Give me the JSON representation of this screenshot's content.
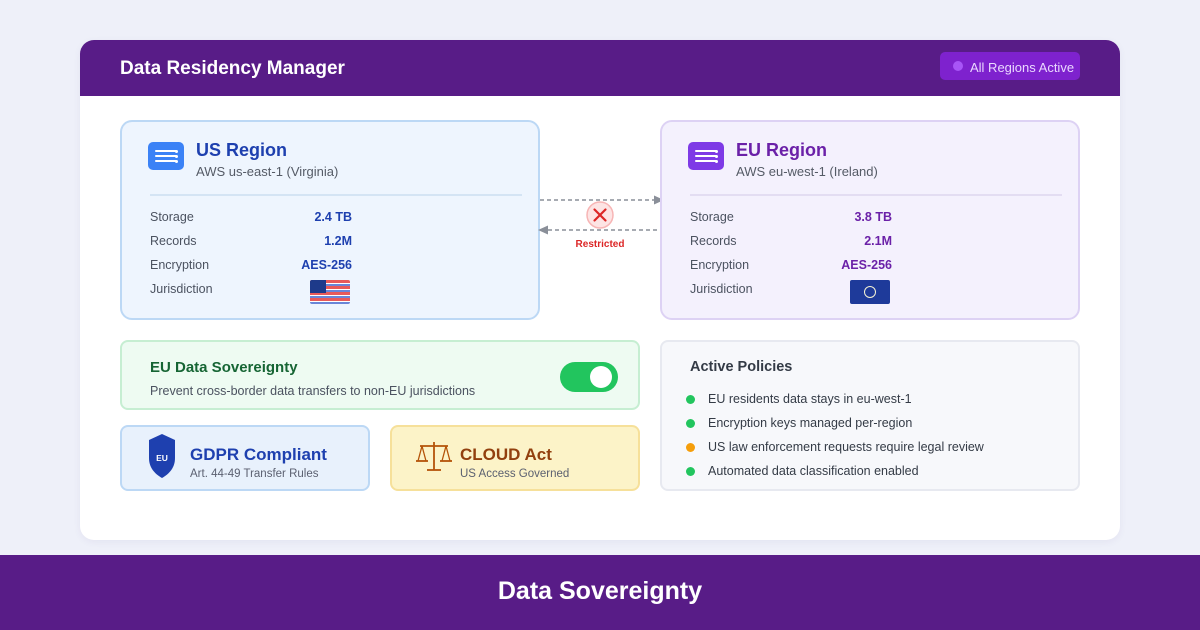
{
  "header": {
    "title": "Data Residency Manager",
    "status_label": "All Regions Active",
    "status_color": "#a855f7"
  },
  "regions": {
    "us": {
      "name": "US Region",
      "provider": "AWS us-east-1 (Virginia)",
      "icon": "server-icon",
      "stats": {
        "storage_label": "Storage",
        "storage_value": "2.4 TB",
        "records_label": "Records",
        "records_value": "1.2M",
        "encryption_label": "Encryption",
        "encryption_value": "AES-256",
        "jurisdiction_label": "Jurisdiction",
        "jurisdiction_flag": "us-flag-icon"
      },
      "accent": "#1e40af"
    },
    "eu": {
      "name": "EU Region",
      "provider": "AWS eu-west-1 (Ireland)",
      "icon": "server-icon",
      "stats": {
        "storage_label": "Storage",
        "storage_value": "3.8 TB",
        "records_label": "Records",
        "records_value": "2.1M",
        "encryption_label": "Encryption",
        "encryption_value": "AES-256",
        "jurisdiction_label": "Jurisdiction",
        "jurisdiction_flag": "eu-flag-icon"
      },
      "accent": "#6b21a8"
    }
  },
  "transfer": {
    "status_label": "Restricted",
    "status_color": "#dc2626"
  },
  "sovereignty": {
    "title": "EU Data Sovereignty",
    "description": "Prevent cross-border data transfers to non-EU jurisdictions",
    "enabled": true,
    "toggle_color": "#22c55e"
  },
  "badges": {
    "gdpr": {
      "icon_text": "EU",
      "title": "GDPR Compliant",
      "subtitle": "Art. 44-49 Transfer Rules"
    },
    "cloud_act": {
      "title": "CLOUD Act",
      "subtitle": "US Access Governed"
    }
  },
  "policies": {
    "title": "Active Policies",
    "items": [
      {
        "text": "EU residents data stays in eu-west-1",
        "status": "ok",
        "color": "#22c55e"
      },
      {
        "text": "Encryption keys managed per-region",
        "status": "ok",
        "color": "#22c55e"
      },
      {
        "text": "US law enforcement requests require legal review",
        "status": "warning",
        "color": "#f59e0b"
      },
      {
        "text": "Automated data classification enabled",
        "status": "ok",
        "color": "#22c55e"
      }
    ]
  },
  "footer": {
    "title": "Data Sovereignty"
  }
}
